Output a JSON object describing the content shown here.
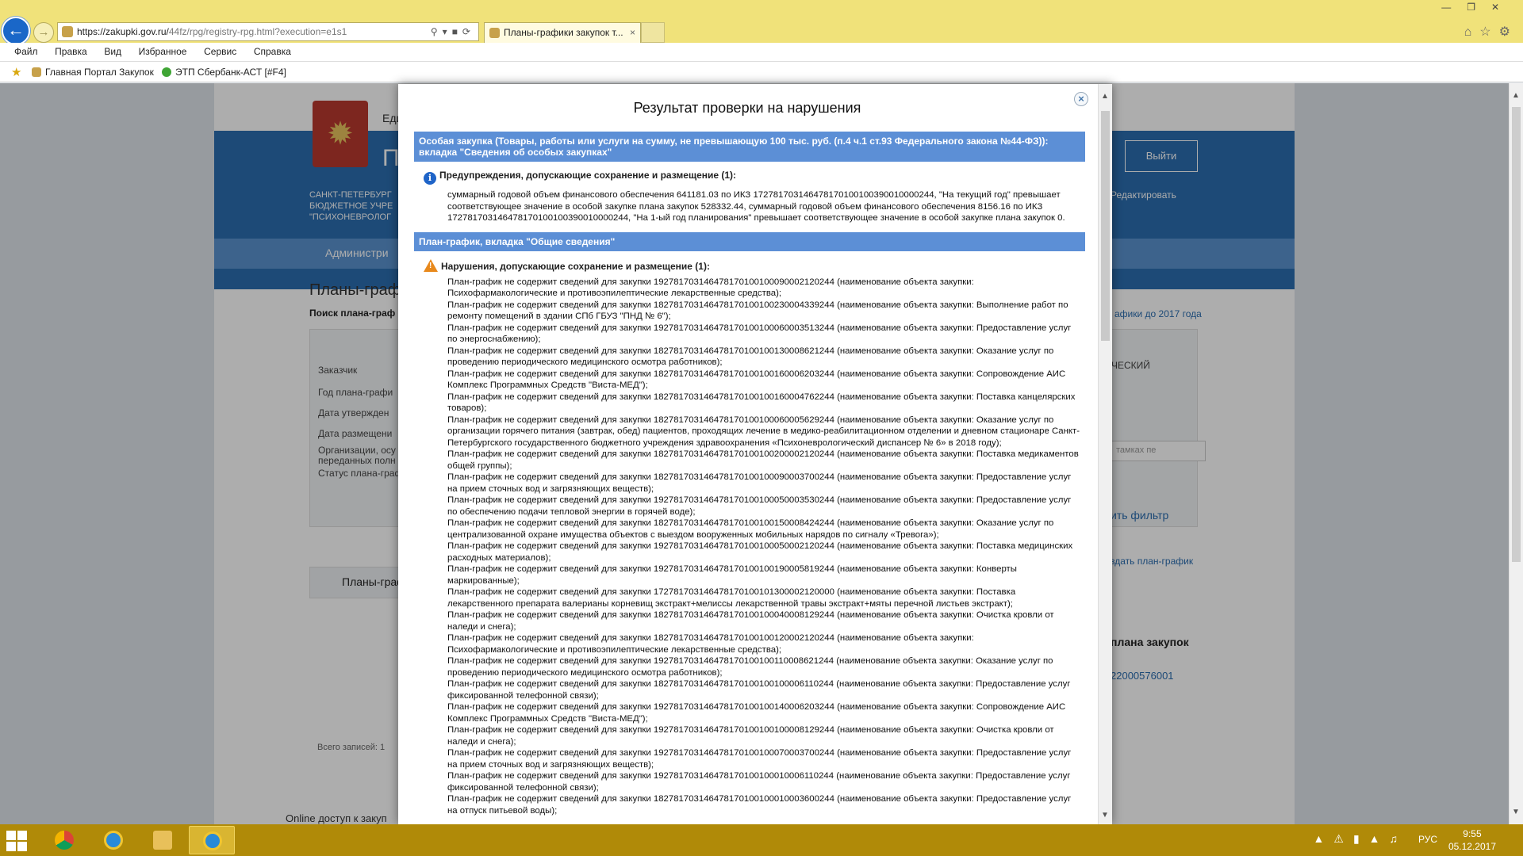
{
  "browser": {
    "url_main": "https://zakupki.gov.ru/",
    "url_rest": "44fz/rpg/registry-rpg.html?execution=e1s1",
    "tab_title": "Планы-графики закупок т...",
    "tab_close": "×",
    "menu": [
      "Файл",
      "Правка",
      "Вид",
      "Избранное",
      "Сервис",
      "Справка"
    ],
    "favorites": [
      "Главная Портал Закупок",
      "ЭТП Сбербанк-АСТ [#F4]"
    ]
  },
  "background_page": {
    "brand_line1": "Еди",
    "brand_line2": "П",
    "org_lines": [
      "САНКТ-ПЕТЕРБУРГ",
      "БЮДЖЕТНОЕ УЧРЕ",
      "\"ПСИХОНЕВРОЛОГ"
    ],
    "logout": "Выйти",
    "edit": "Редактировать",
    "nav_item": "Администри",
    "page_title": "Планы-граф",
    "search_title": "Поиск плана-граф",
    "old_plans_link": "афики до 2017 года",
    "filter_labels": [
      "Заказчик",
      "Год плана-графи",
      "Дата утвержден",
      "Дата размещени",
      "Организации, осу",
      "переданных полн",
      "Статус плана-граф"
    ],
    "filter_right": "ЧЕСКИЙ",
    "search_placeholder": "тамках пе",
    "apply_filter": "ить фильтр",
    "create_plan": "здать план-график",
    "tab_label": "Планы-граф",
    "plan_heading": "плана закупок",
    "plan_number": "22000576001",
    "total": "Всего записей: 1",
    "footer": "Online доступ к закуп"
  },
  "modal": {
    "title": "Результат проверки на нарушения",
    "close": "×",
    "sections": [
      {
        "header": "Особая закупка (Товары, работы или услуги на сумму, не превышающую 100 тыс. руб. (п.4 ч.1 ст.93 Федерального закона №44-ФЗ)): вкладка \"Сведения об особых закупках\"",
        "subheader": "Предупреждения, допускающие сохранение и размещение (1):",
        "icon": "info-icon",
        "messages": [
          "суммарный годовой объем финансового обеспечения 641181.03 по ИКЗ 172781703146478170100100390010000244, \"На текущий год\" превышает соответствующее значение в особой закупке плана закупок 528332.44, суммарный годовой объем финансового обеспечения 8156.16 по ИКЗ 172781703146478170100100390010000244, \"На 1-ый год планирования\" превышает соответствующее значение в особой закупке плана закупок 0."
        ]
      },
      {
        "header": "План-график, вкладка \"Общие сведения\"",
        "subheader": "Нарушения, допускающие сохранение и размещение (1):",
        "icon": "warning-icon",
        "messages": [
          "План-график не содержит сведений для закупки 192781703146478170100100090002120244 (наименование объекта закупки: Психофармакологические и противоэпилептические лекарственные средства);",
          "План-график не содержит сведений для закупки 182781703146478170100100230004339244 (наименование объекта закупки: Выполнение работ по ремонту помещений в здании СПб ГБУЗ \"ПНД № 6\");",
          "План-график не содержит сведений для закупки 192781703146478170100100060003513244 (наименование объекта закупки: Предоставление услуг по энергоснабжению);",
          "План-график не содержит сведений для закупки 182781703146478170100100130008621244 (наименование объекта закупки: Оказание услуг по проведению периодического медицинского осмотра работников);",
          "План-график не содержит сведений для закупки 182781703146478170100100160006203244 (наименование объекта закупки: Сопровождение АИС Комплекс Программных Средств \"Виста-МЕД\");",
          "План-график не содержит сведений для закупки 182781703146478170100100160004762244 (наименование объекта закупки: Поставка канцелярских товаров);",
          "План-график не содержит сведений для закупки 182781703146478170100100060005629244 (наименование объекта закупки: Оказание услуг по организации горячего питания (завтрак, обед) пациентов, проходящих лечение в медико-реабилитационном отделении и дневном стационаре Санкт-Петербургского государственного бюджетного учреждения здравоохранения «Психоневрологический диспансер № 6» в 2018 году);",
          "План-график не содержит сведений для закупки 182781703146478170100100200002120244 (наименование объекта закупки: Поставка медикаментов общей группы);",
          "План-график не содержит сведений для закупки 182781703146478170100100090003700244 (наименование объекта закупки: Предоставление услуг на прием сточных вод и загрязняющих веществ);",
          "План-график не содержит сведений для закупки 192781703146478170100100050003530244 (наименование объекта закупки: Предоставление услуг по обеспечению подачи тепловой энергии в горячей воде);",
          "План-график не содержит сведений для закупки 182781703146478170100100150008424244 (наименование объекта закупки: Оказание услуг по централизованной охране имущества объектов с выездом вооруженных мобильных нарядов по сигналу «Тревога»);",
          "План-график не содержит сведений для закупки 192781703146478170100100050002120244 (наименование объекта закупки: Поставка медицинских расходных материалов);",
          "План-график не содержит сведений для закупки 192781703146478170100100190005819244 (наименование объекта закупки: Конверты маркированные);",
          "План-график не содержит сведений для закупки 172781703146478170100101300002120000 (наименование объекта закупки: Поставка лекарственного препарата валерианы корневищ экстракт+мелиссы лекарственной травы экстракт+мяты перечной листьев экстракт);",
          "План-график не содержит сведений для закупки 182781703146478170100100040008129244 (наименование объекта закупки: Очистка кровли от наледи и снега);",
          "План-график не содержит сведений для закупки 182781703146478170100100120002120244 (наименование объекта закупки: Психофармакологические и противоэпилептические лекарственные средства);",
          "План-график не содержит сведений для закупки 192781703146478170100100110008621244 (наименование объекта закупки: Оказание услуг по проведению периодического медицинского осмотра работников);",
          "План-график не содержит сведений для закупки 182781703146478170100100100006110244 (наименование объекта закупки: Предоставление услуг фиксированной телефонной связи);",
          "План-график не содержит сведений для закупки 192781703146478170100100140006203244 (наименование объекта закупки: Сопровождение АИС Комплекс Программных Средств \"Виста-МЕД\");",
          "План-график не содержит сведений для закупки 192781703146478170100100100008129244 (наименование объекта закупки: Очистка кровли от наледи и снега);",
          "План-график не содержит сведений для закупки 192781703146478170100100070003700244 (наименование объекта закупки: Предоставление услуг на прием сточных вод и загрязняющих веществ);",
          "План-график не содержит сведений для закупки 192781703146478170100100010006110244 (наименование объекта закупки: Предоставление услуг фиксированной телефонной связи);",
          "План-график не содержит сведений для закупки 182781703146478170100100010003600244 (наименование объекта закупки: Предоставление услуг на отпуск питьевой воды);"
        ]
      }
    ]
  },
  "taskbar": {
    "lang": "РУС",
    "time": "9:55",
    "date": "05.12.2017"
  },
  "colors": {
    "chrome_yellow": "#f0e27a",
    "taskbar": "#b08a08",
    "section_header": "#5c8fd6",
    "site_blue": "#2b6db0"
  }
}
